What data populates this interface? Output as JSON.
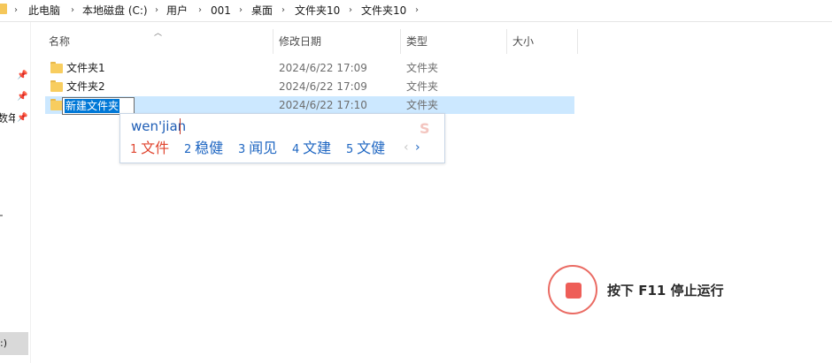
{
  "breadcrumb": {
    "items": [
      "此电脑",
      "本地磁盘 (C:)",
      "用户",
      "001",
      "桌面",
      "文件夹10",
      "文件夹10"
    ]
  },
  "nav": {
    "fragment_label": "数年",
    "drive_fragment": ":)"
  },
  "columns": {
    "name": "名称",
    "modified": "修改日期",
    "type": "类型",
    "size": "大小"
  },
  "files": [
    {
      "name": "文件夹1",
      "modified": "2024/6/22 17:09",
      "type": "文件夹"
    },
    {
      "name": "文件夹2",
      "modified": "2024/6/22 17:09",
      "type": "文件夹"
    },
    {
      "name": "新建文件夹",
      "modified": "2024/6/22 17:10",
      "type": "文件夹"
    }
  ],
  "rename": {
    "value": "新建文件夹"
  },
  "ime": {
    "composition": "wen'jian",
    "candidates": [
      {
        "num": "1",
        "word": "文件"
      },
      {
        "num": "2",
        "word": "稳健"
      },
      {
        "num": "3",
        "word": "闻见"
      },
      {
        "num": "4",
        "word": "文建"
      },
      {
        "num": "5",
        "word": "文健"
      }
    ],
    "prev": "‹",
    "next": "›"
  },
  "overlay": {
    "stop_text": "按下 F11 停止运行",
    "accent": "#ee5e58"
  },
  "colors": {
    "selection": "#cce8ff",
    "rename_highlight": "#0078d7",
    "folder": "#f8cd5f",
    "candidate_first": "#e0452f",
    "candidate_other": "#1e66c2"
  }
}
